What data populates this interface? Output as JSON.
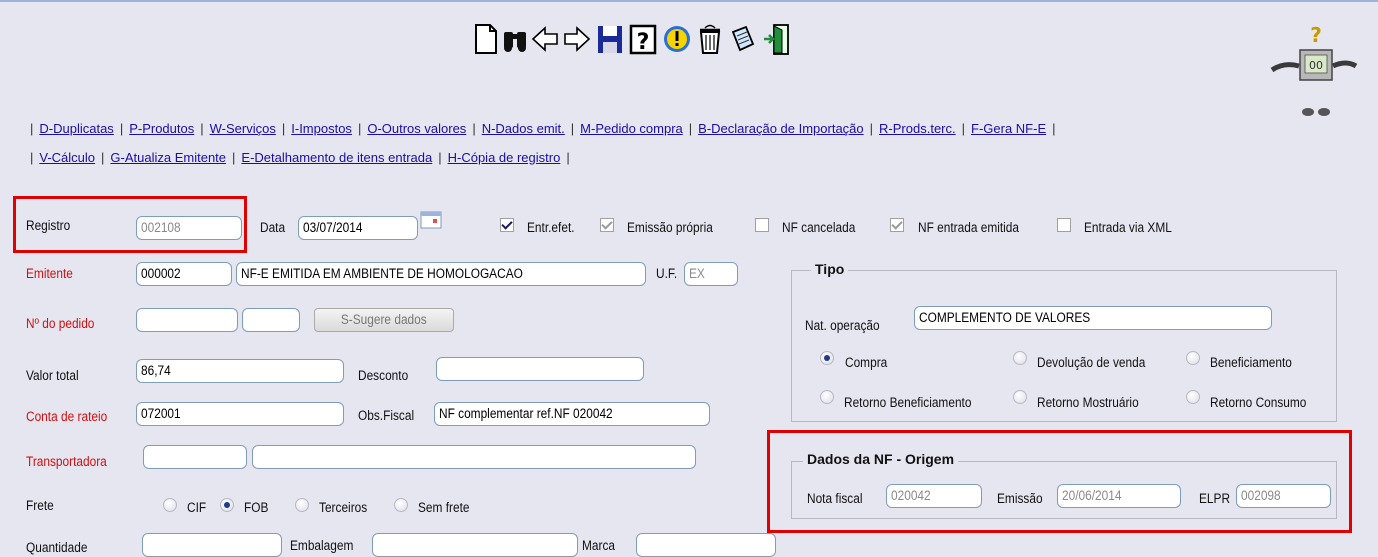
{
  "toolbar": {
    "icons": [
      "new-document-icon",
      "binoculars-search-icon",
      "arrow-left-icon",
      "arrow-right-icon",
      "save-disk-icon",
      "help-question-icon",
      "info-exclamation-icon",
      "trash-bin-icon",
      "notepad-edit-icon",
      "exit-door-icon"
    ]
  },
  "links_row1": [
    "D-Duplicatas",
    "P-Produtos",
    "W-Serviços",
    "I-Impostos",
    "O-Outros valores",
    "N-Dados emit.",
    "M-Pedido compra",
    "B-Declaração de Importação",
    "R-Prods.terc.",
    "F-Gera NF-E"
  ],
  "links_row2": [
    "V-Cálculo",
    "G-Atualiza Emitente",
    "E-Detalhamento de itens entrada",
    "H-Cópia de registro"
  ],
  "form": {
    "registro_label": "Registro",
    "registro_value": "002108",
    "data_label": "Data",
    "data_value": "03/07/2014",
    "entr_efet_label": "Entr.efet.",
    "emissao_propria_label": "Emissão própria",
    "nf_cancelada_label": "NF cancelada",
    "nf_entrada_emitida_label": "NF entrada emitida",
    "entrada_via_xml_label": "Entrada via XML",
    "emitente_label": "Emitente",
    "emitente_code": "000002",
    "emitente_name": "NF-E EMITIDA EM AMBIENTE DE HOMOLOGACAO",
    "uf_label": "U.F.",
    "uf_value": "EX",
    "pedido_label": "Nº do pedido",
    "sugere_button": "S-Sugere dados",
    "valor_total_label": "Valor total",
    "valor_total_value": "86,74",
    "desconto_label": "Desconto",
    "conta_rateio_label": "Conta de rateio",
    "conta_rateio_value": "072001",
    "obs_fiscal_label": "Obs.Fiscal",
    "obs_fiscal_value": "NF complementar ref.NF 020042",
    "transportadora_label": "Transportadora",
    "frete_label": "Frete",
    "frete_options": [
      "CIF",
      "FOB",
      "Terceiros",
      "Sem frete"
    ],
    "quantidade_label": "Quantidade",
    "embalagem_label": "Embalagem",
    "marca_label": "Marca"
  },
  "tipo": {
    "title": "Tipo",
    "nat_operacao_label": "Nat. operação",
    "nat_operacao_value": "COMPLEMENTO DE VALORES",
    "options": [
      "Compra",
      "Devolução de venda",
      "Beneficiamento",
      "Retorno Beneficiamento",
      "Retorno Mostruário",
      "Retorno Consumo"
    ]
  },
  "origem": {
    "title": "Dados da NF - Origem",
    "nota_fiscal_label": "Nota fiscal",
    "nota_fiscal_value": "020042",
    "emissao_label": "Emissão",
    "emissao_value": "20/06/2014",
    "elpr_label": "ELPR",
    "elpr_value": "002098"
  },
  "colors": {
    "highlight": "#e00000",
    "link": "#1a0dab",
    "required_label": "#d01010",
    "background": "#e6e6f1"
  }
}
